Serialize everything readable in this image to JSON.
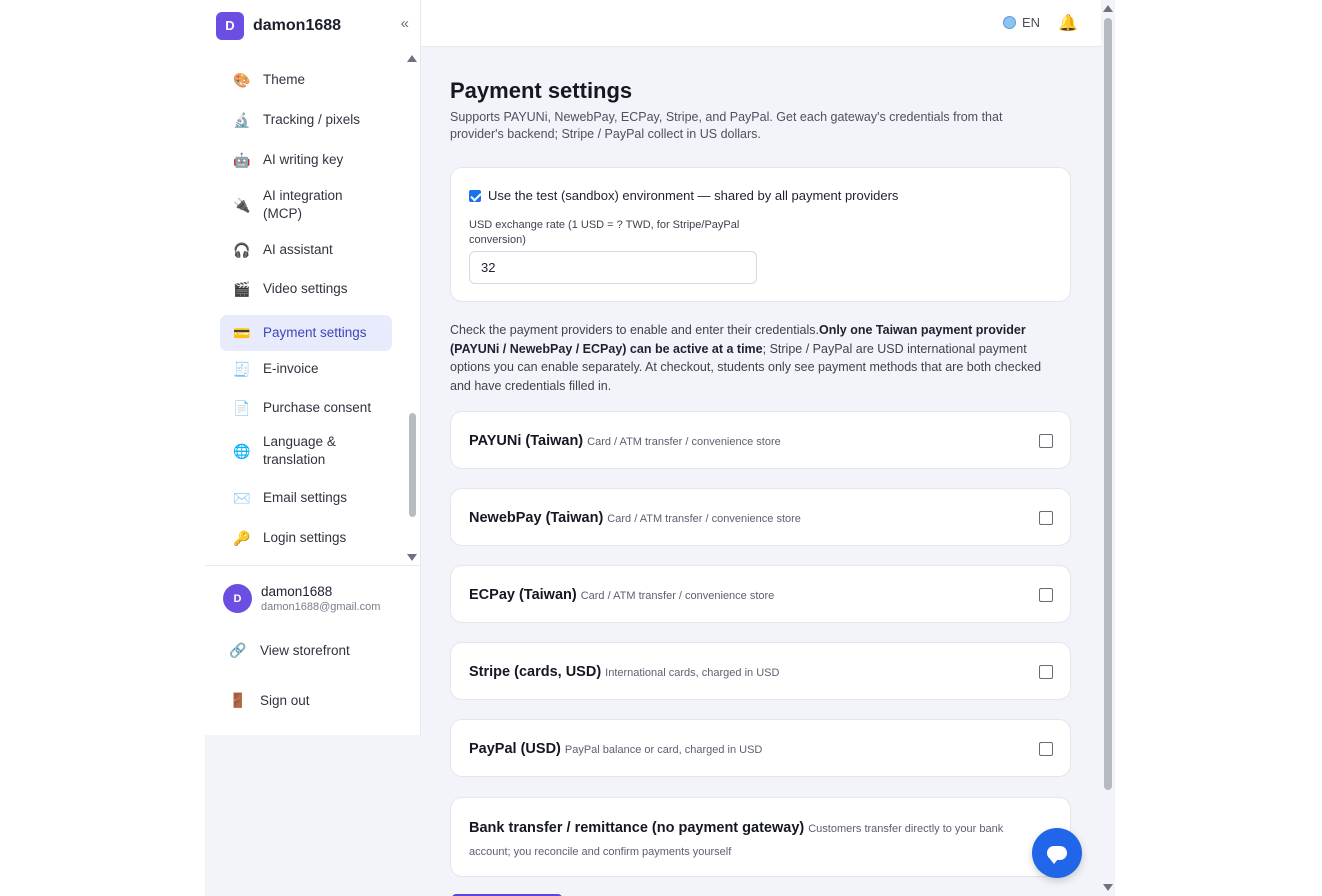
{
  "brand": {
    "initial": "D",
    "name": "damon1688",
    "collapse_glyph": "«"
  },
  "nav": {
    "items": [
      {
        "name": "nav-item-theme",
        "icon": "palette-icon",
        "glyph": "🎨",
        "label": "Theme",
        "active": false
      },
      {
        "name": "nav-item-tracking",
        "icon": "microscope-icon",
        "glyph": "🔬",
        "label": "Tracking / pixels",
        "active": false
      },
      {
        "name": "nav-item-ai-writing-key",
        "icon": "robot-icon",
        "glyph": "🤖",
        "label": "AI writing key",
        "active": false
      },
      {
        "name": "nav-item-ai-integration",
        "icon": "plug-icon",
        "glyph": "🔌",
        "label": "AI integration (MCP)",
        "active": false
      },
      {
        "name": "nav-item-ai-assistant",
        "icon": "headphones-icon",
        "glyph": "🎧",
        "label": "AI assistant",
        "active": false
      },
      {
        "name": "nav-item-video-settings",
        "icon": "clapperboard-icon",
        "glyph": "🎬",
        "label": "Video settings",
        "active": false
      },
      {
        "name": "nav-item-payment-settings",
        "icon": "credit-card-icon",
        "glyph": "💳",
        "label": "Payment settings",
        "active": true
      },
      {
        "name": "nav-item-e-invoice",
        "icon": "receipt-icon",
        "glyph": "🧾",
        "label": "E-invoice",
        "active": false
      },
      {
        "name": "nav-item-purchase-consent",
        "icon": "document-icon",
        "glyph": "📄",
        "label": "Purchase consent",
        "active": false
      },
      {
        "name": "nav-item-language",
        "icon": "globe-icon",
        "glyph": "🌐",
        "label": "Language & translation",
        "active": false
      },
      {
        "name": "nav-item-email-settings",
        "icon": "envelope-icon",
        "glyph": "✉️",
        "label": "Email settings",
        "active": false
      },
      {
        "name": "nav-item-login-settings",
        "icon": "key-icon",
        "glyph": "🔑",
        "label": "Login settings",
        "active": false
      }
    ]
  },
  "user": {
    "initial": "D",
    "name": "damon1688",
    "email": "damon1688@gmail.com"
  },
  "side_links": [
    {
      "name": "view-storefront-link",
      "icon": "link-icon",
      "glyph": "🔗",
      "label": "View storefront"
    },
    {
      "name": "sign-out-link",
      "icon": "door-icon",
      "glyph": "🚪",
      "label": "Sign out"
    }
  ],
  "header": {
    "lang_label": "EN"
  },
  "page": {
    "title": "Payment settings",
    "subtitle": "Supports PAYUNi, NewebPay, ECPay, Stripe, and PayPal. Get each gateway's credentials from that provider's backend; Stripe / PayPal collect in US dollars.",
    "sandbox_label": "Use the test (sandbox) environment — shared by all payment providers",
    "sandbox_checked": true,
    "rate_label": "USD exchange rate (1 USD = ? TWD, for Stripe/PayPal conversion)",
    "rate_value": "32",
    "info_pre": "Check the payment providers to enable and enter their credentials.",
    "info_bold": "Only one Taiwan payment provider (PAYUNi / NewebPay / ECPay) can be active at a time",
    "info_post": "; Stripe / PayPal are USD international payment options you can enable separately. At checkout, students only see payment methods that are both checked and have credentials filled in."
  },
  "providers": [
    {
      "name": "provider-payuni",
      "title": "PAYUNi (Taiwan)",
      "desc": "Card / ATM transfer / convenience store",
      "checked": false
    },
    {
      "name": "provider-newebpay",
      "title": "NewebPay (Taiwan)",
      "desc": "Card / ATM transfer / convenience store",
      "checked": false
    },
    {
      "name": "provider-ecpay",
      "title": "ECPay (Taiwan)",
      "desc": "Card / ATM transfer / convenience store",
      "checked": false
    },
    {
      "name": "provider-stripe",
      "title": "Stripe (cards, USD)",
      "desc": "International cards, charged in USD",
      "checked": false
    },
    {
      "name": "provider-paypal",
      "title": "PayPal (USD)",
      "desc": "PayPal balance or card, charged in USD",
      "checked": false
    }
  ],
  "bank": {
    "title": "Bank transfer / remittance (no payment gateway)",
    "desc": "Customers transfer directly to your bank account; you reconcile and confirm payments yourself"
  },
  "colors": {
    "accent": "#6c4ee3",
    "active_nav_bg": "#e8ebfb",
    "chat_button": "#2166e8"
  }
}
